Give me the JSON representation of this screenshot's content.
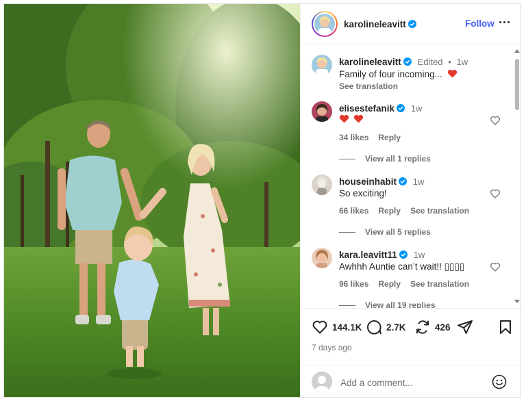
{
  "post": {
    "author": {
      "username": "karolineleavitt",
      "verified": true,
      "follow_label": "Follow"
    },
    "more_icon": "more-horizontal-icon"
  },
  "caption": {
    "username": "karolineleavitt",
    "edited": "Edited",
    "separator": "•",
    "age": "1w",
    "text": "Family of four incoming...",
    "emoji": "heart-emoji",
    "see_translation": "See translation"
  },
  "comments": [
    {
      "username": "elisestefanik",
      "age": "1w",
      "text_emoji": [
        "heart-emoji",
        "heart-emoji"
      ],
      "likes": "34 likes",
      "reply": "Reply",
      "view_replies": "View all 1 replies"
    },
    {
      "username": "houseinhabit",
      "age": "1w",
      "text": "So exciting!",
      "likes": "66 likes",
      "reply": "Reply",
      "see_translation": "See translation",
      "view_replies": "View all 5 replies"
    },
    {
      "username": "kara.leavitt11",
      "age": "1w",
      "text": "Awhhh Auntie can’t wait!! ▯▯▯▯",
      "likes": "96 likes",
      "reply": "Reply",
      "see_translation": "See translation",
      "view_replies": "View all 19 replies"
    }
  ],
  "actions": {
    "likes": "144.1K",
    "comments": "2.7K",
    "reposts": "426",
    "posted": "7 days ago"
  },
  "composer": {
    "placeholder": "Add a comment..."
  },
  "colors": {
    "accent": "#4a5df9",
    "verified": "#0095f6",
    "heart": "#ed4956",
    "muted": "#737373"
  }
}
